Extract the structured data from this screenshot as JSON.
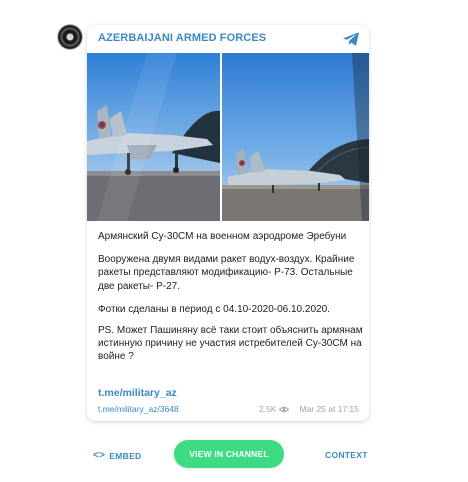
{
  "channel": {
    "name": "AZERBAIJANI ARMED FORCES",
    "avatar_icon": "channel-avatar",
    "app_icon": "telegram-icon"
  },
  "post": {
    "photos": [
      {
        "description_icon": "fighter-jet-photo-left"
      },
      {
        "description_icon": "fighter-jet-photo-right"
      }
    ],
    "paragraphs": [
      "Армянский Су-30СМ на военном аэродроме Эребуни",
      "Вооружена двумя видами ракет водух-воздух. Крайние ракеты представляют модификацию- Р-73. Остальные две ракеты- Р-27.",
      "Фотки сделаны в период с 04.10-2020-06.10.2020.",
      "PS. Может Пашиняну всё таки стоит объяснить армянам истинную причину не участия истребителей Су-30СМ на войне ?"
    ],
    "channel_link": "t.me/military_az",
    "post_link": "t.me/military_az/3648",
    "views": "2.5K",
    "date": "Mar 25 at 17:15"
  },
  "footer": {
    "embed_label": "EMBED",
    "view_label": "VIEW IN CHANNEL",
    "context_label": "CONTEXT"
  },
  "colors": {
    "accent": "#3a8ac4",
    "button": "#3ddc84",
    "meta": "#9aa4ad"
  }
}
